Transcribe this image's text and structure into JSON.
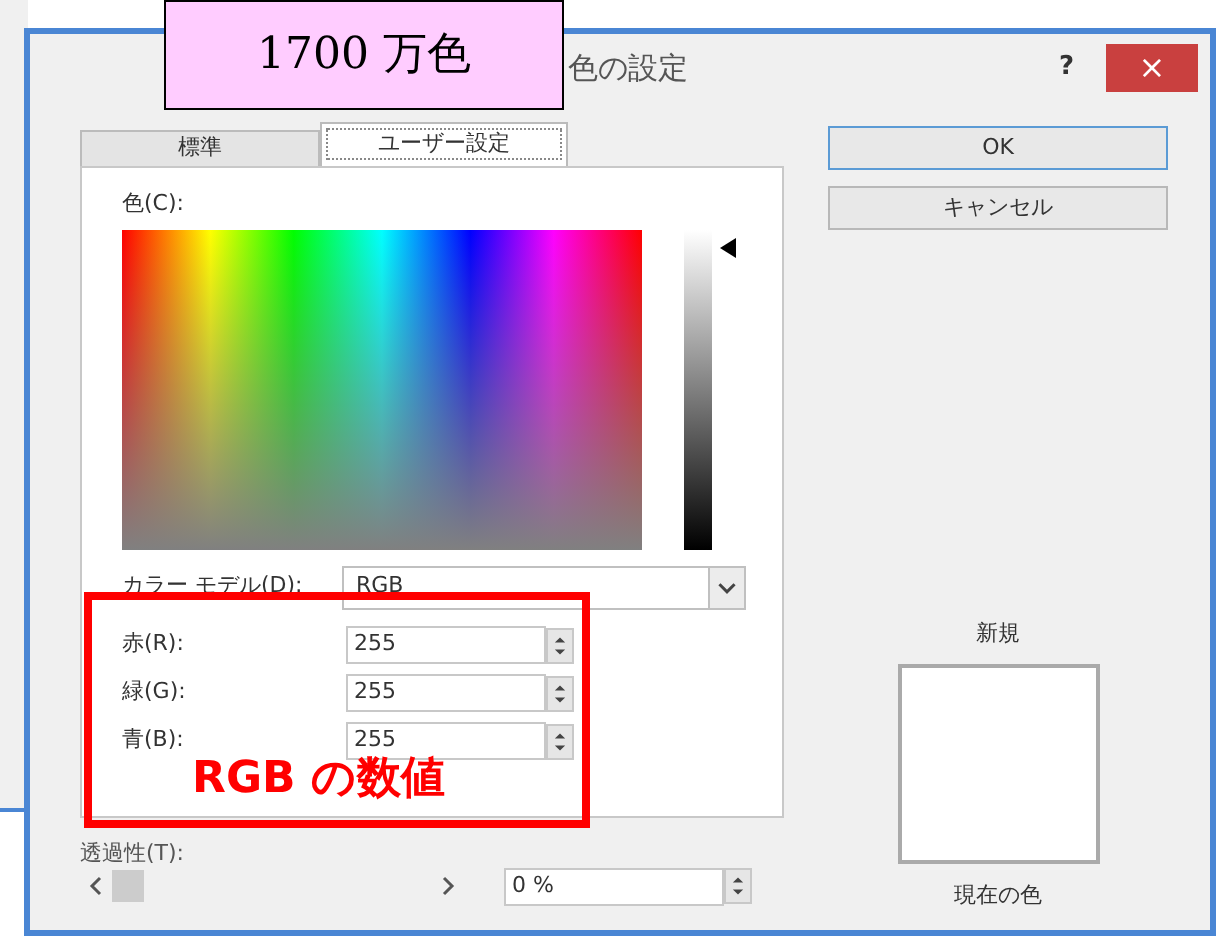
{
  "annotation_label": "1700 万色",
  "annotation_note": "RGB の数値",
  "window": {
    "title": "色の設定",
    "help": "?",
    "close": "×"
  },
  "tabs": [
    {
      "label": "標準",
      "selected": false
    },
    {
      "label": "ユーザー設定",
      "selected": true
    }
  ],
  "color_label": "色(C):",
  "luminance": {
    "level": 0.97
  },
  "color_model": {
    "label": "カラー モデル(D):",
    "value": "RGB"
  },
  "channels": [
    {
      "label": "赤(R):",
      "value": "255"
    },
    {
      "label": "緑(G):",
      "value": "255"
    },
    {
      "label": "青(B):",
      "value": "255"
    }
  ],
  "transparency": {
    "label": "透過性(T):",
    "level": 0,
    "value": "0 %"
  },
  "buttons": [
    "OK",
    "キャンセル"
  ],
  "preview": {
    "new_label": "新規",
    "current_label": "現在の色",
    "color": "#ffffff"
  }
}
